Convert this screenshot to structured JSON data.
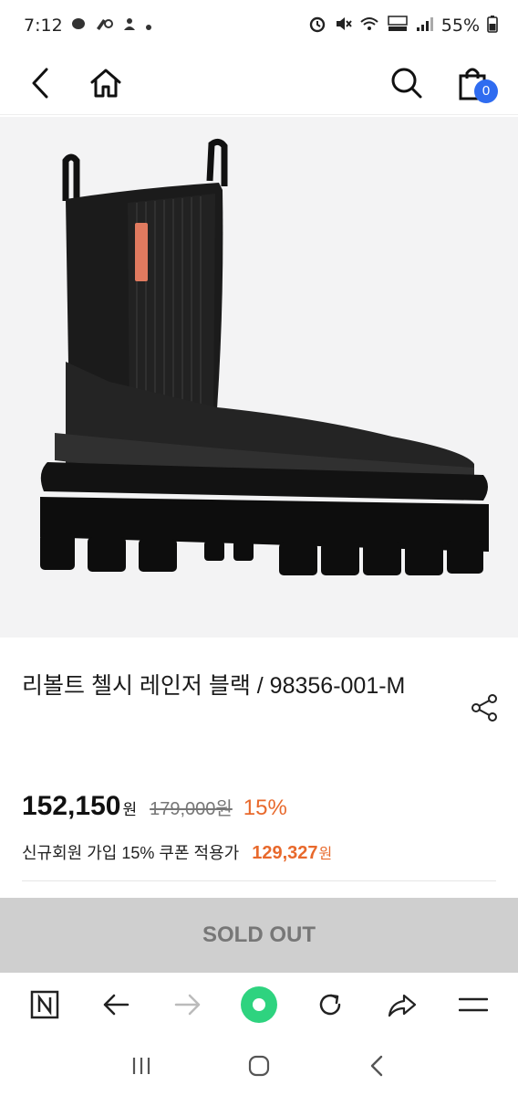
{
  "status": {
    "time": "7:12",
    "left_icons": [
      "chat-icon",
      "vpn-key-icon",
      "notification-icon",
      "dot-icon"
    ],
    "right_icons": [
      "alarm-icon",
      "mute-icon",
      "wifi-icon",
      "volte-icon",
      "signal-icon"
    ],
    "battery": "55%"
  },
  "nav": {
    "cart_count": "0"
  },
  "product": {
    "title": "리볼트 첼시 레인저 블랙 / 98356-001-M",
    "price": "152,150",
    "price_unit": "원",
    "original_price": "179,000원",
    "discount": "15%",
    "coupon_label": "신규회원 가입 15% 쿠폰 적용가",
    "coupon_price": "129,327",
    "coupon_unit": "원",
    "accent_color": "#e8692c"
  },
  "actions": {
    "sold_out_label": "SOLD OUT"
  }
}
